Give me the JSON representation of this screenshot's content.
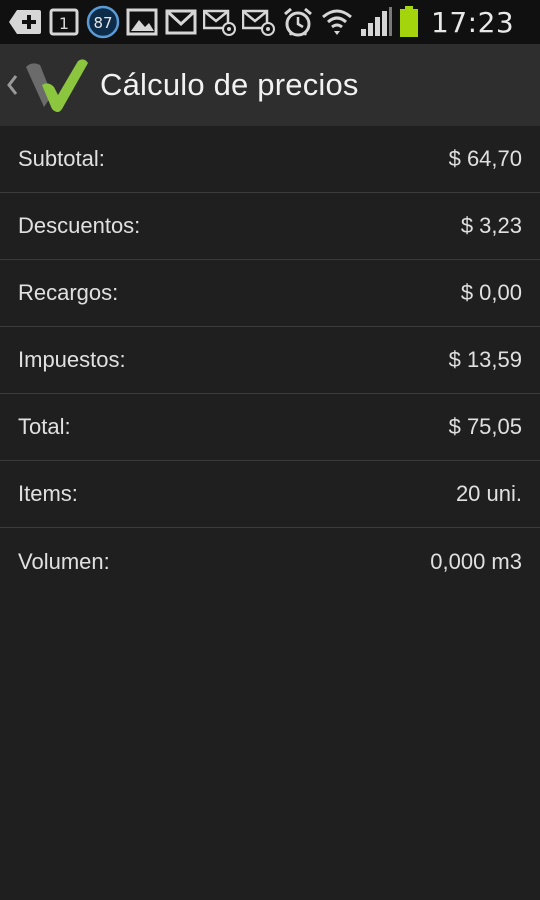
{
  "status_bar": {
    "icons": [
      "add-icon",
      "sim-1-icon",
      "notification-count-badge",
      "gallery-icon",
      "gmail-icon",
      "email-icon",
      "email-icon",
      "alarm-icon",
      "wifi-icon",
      "signal-icon",
      "battery-icon"
    ],
    "badge_count": "87",
    "sim_label": "1",
    "time": "17:23",
    "battery_color": "#a4d40c"
  },
  "action_bar": {
    "title": "Cálculo de precios",
    "logo_color": "#8cc63f",
    "logo_shadow_color": "#6b6b6b"
  },
  "rows": [
    {
      "label": "Subtotal:",
      "value": "$ 64,70"
    },
    {
      "label": "Descuentos:",
      "value": "$ 3,23"
    },
    {
      "label": "Recargos:",
      "value": "$ 0,00"
    },
    {
      "label": "Impuestos:",
      "value": "$ 13,59"
    },
    {
      "label": "Total:",
      "value": "$ 75,05"
    },
    {
      "label": "Items:",
      "value": "20 uni."
    },
    {
      "label": "Volumen:",
      "value": "0,000 m3"
    }
  ]
}
